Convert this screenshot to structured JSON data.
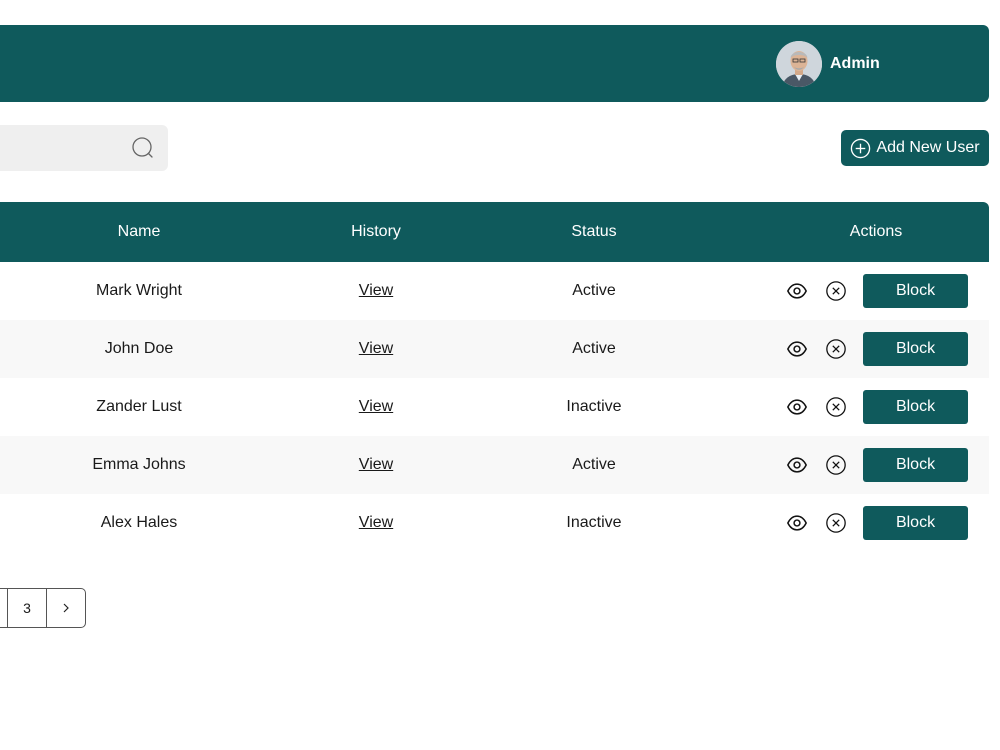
{
  "header": {
    "user_name": "Admin"
  },
  "toolbar": {
    "add_user_label": "Add New User"
  },
  "table": {
    "columns": [
      "Name",
      "History",
      "Status",
      "Actions"
    ],
    "rows": [
      {
        "name": "Mark Wright",
        "history": "View",
        "status": "Active",
        "action": "Block"
      },
      {
        "name": "John Doe",
        "history": "View",
        "status": "Active",
        "action": "Block"
      },
      {
        "name": "Zander Lust",
        "history": "View",
        "status": "Inactive",
        "action": "Block"
      },
      {
        "name": "Emma Johns",
        "history": "View",
        "status": "Active",
        "action": "Block"
      },
      {
        "name": "Alex Hales",
        "history": "View",
        "status": "Inactive",
        "action": "Block"
      }
    ]
  },
  "pagination": {
    "current": "3",
    "next_icon": "chevron-right-icon"
  },
  "colors": {
    "primary": "#0f5a5c",
    "row_alt": "#f8f8f8",
    "search_bg": "#efefef"
  }
}
